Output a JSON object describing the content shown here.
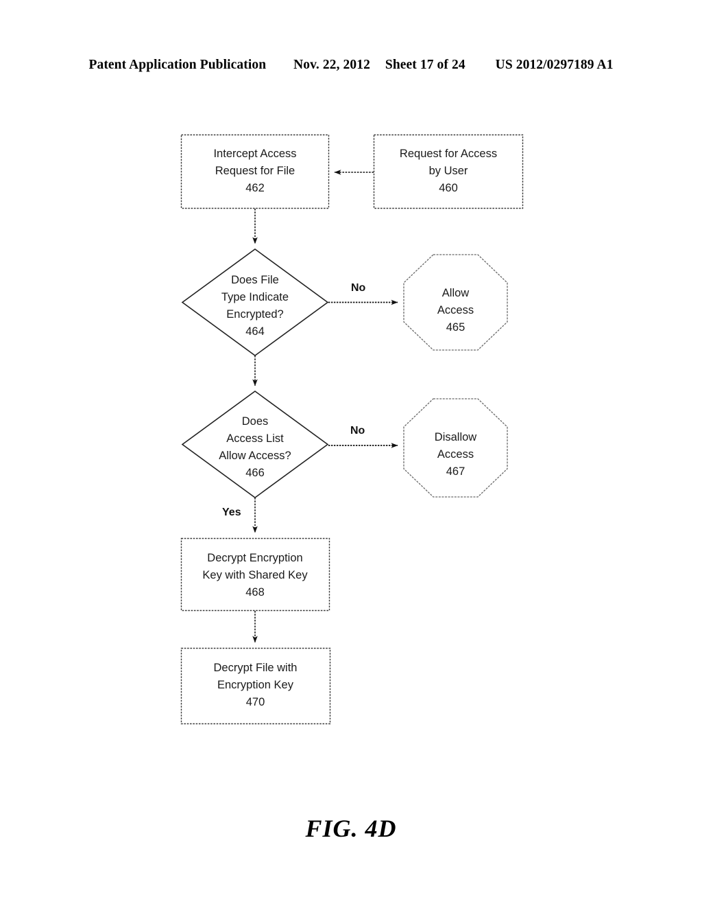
{
  "header": {
    "publication": "Patent Application Publication",
    "date": "Nov. 22, 2012",
    "sheet": "Sheet 17 of 24",
    "pub_number": "US 2012/0297189 A1"
  },
  "figure": {
    "caption": "FIG. 4D"
  },
  "colors": {
    "ink": "#000000",
    "shape_stroke": "#555555",
    "text": "#1a1a1a",
    "background": "#ffffff"
  },
  "diagram": {
    "type": "flowchart",
    "nodes": [
      {
        "id": "460",
        "shape": "rectangle",
        "lines": [
          "Request for Access",
          "by User"
        ],
        "ref": "460"
      },
      {
        "id": "462",
        "shape": "rectangle",
        "lines": [
          "Intercept Access",
          "Request for File"
        ],
        "ref": "462"
      },
      {
        "id": "464",
        "shape": "diamond",
        "lines": [
          "Does File",
          "Type Indicate",
          "Encrypted?"
        ],
        "ref": "464"
      },
      {
        "id": "465",
        "shape": "octagon",
        "lines": [
          "Allow",
          "Access"
        ],
        "ref": "465"
      },
      {
        "id": "466",
        "shape": "diamond",
        "lines": [
          "Does",
          "Access List",
          "Allow Access?"
        ],
        "ref": "466"
      },
      {
        "id": "467",
        "shape": "octagon",
        "lines": [
          "Disallow",
          "Access"
        ],
        "ref": "467"
      },
      {
        "id": "468",
        "shape": "rectangle",
        "lines": [
          "Decrypt Encryption",
          "Key with Shared Key"
        ],
        "ref": "468"
      },
      {
        "id": "470",
        "shape": "rectangle",
        "lines": [
          "Decrypt File with",
          "Encryption Key"
        ],
        "ref": "470"
      }
    ],
    "edges": [
      {
        "from": "460",
        "to": "462",
        "label": ""
      },
      {
        "from": "462",
        "to": "464",
        "label": ""
      },
      {
        "from": "464",
        "to": "465",
        "label": "No"
      },
      {
        "from": "464",
        "to": "466",
        "label": ""
      },
      {
        "from": "466",
        "to": "467",
        "label": "No"
      },
      {
        "from": "466",
        "to": "468",
        "label": "Yes"
      },
      {
        "from": "468",
        "to": "470",
        "label": ""
      }
    ],
    "edge_labels": {
      "no_1": "No",
      "no_2": "No",
      "yes_1": "Yes"
    }
  }
}
